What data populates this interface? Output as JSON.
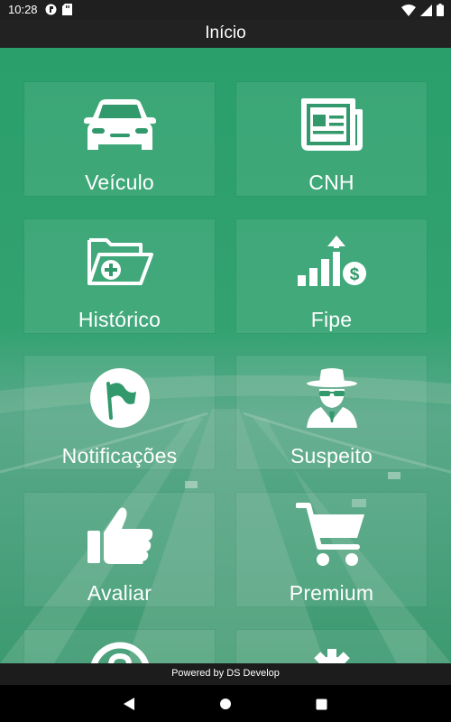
{
  "status_bar": {
    "time": "10:28"
  },
  "app_bar": {
    "title": "Início"
  },
  "menu": {
    "items": [
      {
        "label": "Veículo",
        "icon": "car-icon"
      },
      {
        "label": "CNH",
        "icon": "document-card-icon"
      },
      {
        "label": "Histórico",
        "icon": "folder-add-icon"
      },
      {
        "label": "Fipe",
        "icon": "price-chart-icon"
      },
      {
        "label": "Notificações",
        "icon": "flag-icon"
      },
      {
        "label": "Suspeito",
        "icon": "spy-icon"
      },
      {
        "label": "Avaliar",
        "icon": "thumbs-up-icon"
      },
      {
        "label": "Premium",
        "icon": "cart-icon"
      },
      {
        "label": "",
        "icon": "help-icon"
      },
      {
        "label": "",
        "icon": "settings-icon"
      }
    ]
  },
  "footer": {
    "text": "Powered by DS Develop"
  },
  "colors": {
    "accent": "#2f9a6d",
    "tile_overlay": "rgba(255,255,255,0.08)",
    "bar": "#222222"
  }
}
